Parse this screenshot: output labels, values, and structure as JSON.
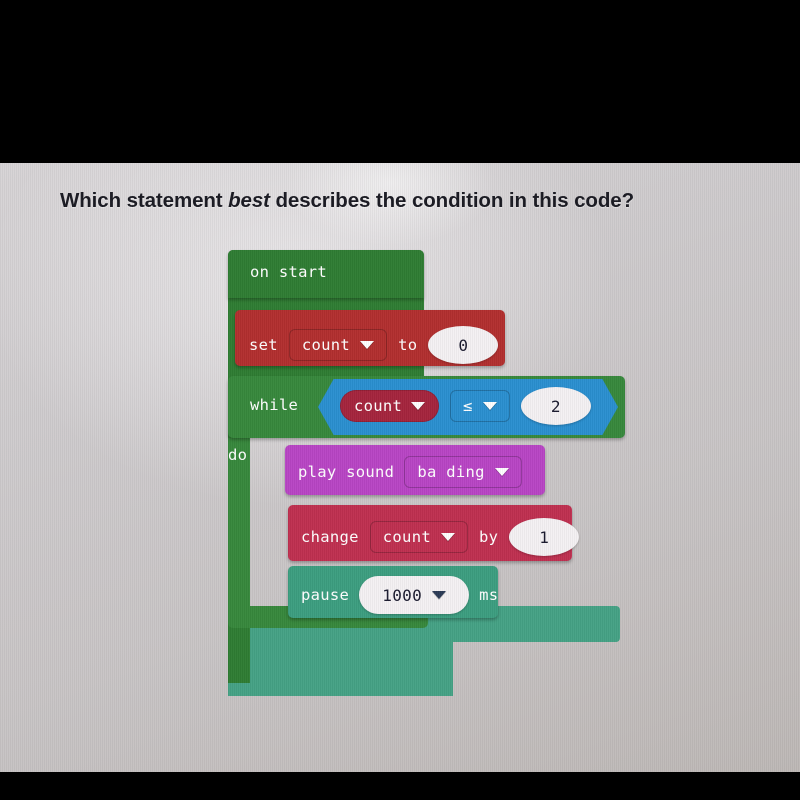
{
  "question": {
    "prefix": "Which statement ",
    "emphasis": "best",
    "suffix": " describes the condition in this code?"
  },
  "code": {
    "on_start": {
      "label": "on start"
    },
    "set_block": {
      "keyword": "set",
      "variable": "count",
      "connector": "to",
      "value": "0"
    },
    "while_block": {
      "keyword": "while",
      "do_label": "do",
      "condition": {
        "left_operand": "count",
        "operator": "≤",
        "right_operand": "2"
      }
    },
    "play_sound_block": {
      "keyword": "play sound",
      "sound": "ba ding"
    },
    "change_block": {
      "keyword": "change",
      "variable": "count",
      "connector": "by",
      "value": "1"
    },
    "pause_block": {
      "keyword": "pause",
      "duration": "1000",
      "unit": "ms"
    }
  },
  "colors": {
    "on_start_green": "#2f7d33",
    "while_green": "#37883c",
    "set_red": "#b22f2f",
    "variable_pill_red": "#a5243d",
    "boolean_blue": "#2a8fd0",
    "play_sound_purple": "#b845c4",
    "change_crimson": "#bf3050",
    "pause_teal": "#3c9e80",
    "letterbox_black": "#000000"
  },
  "icons": {
    "dropdown": "chevron-down-icon"
  }
}
